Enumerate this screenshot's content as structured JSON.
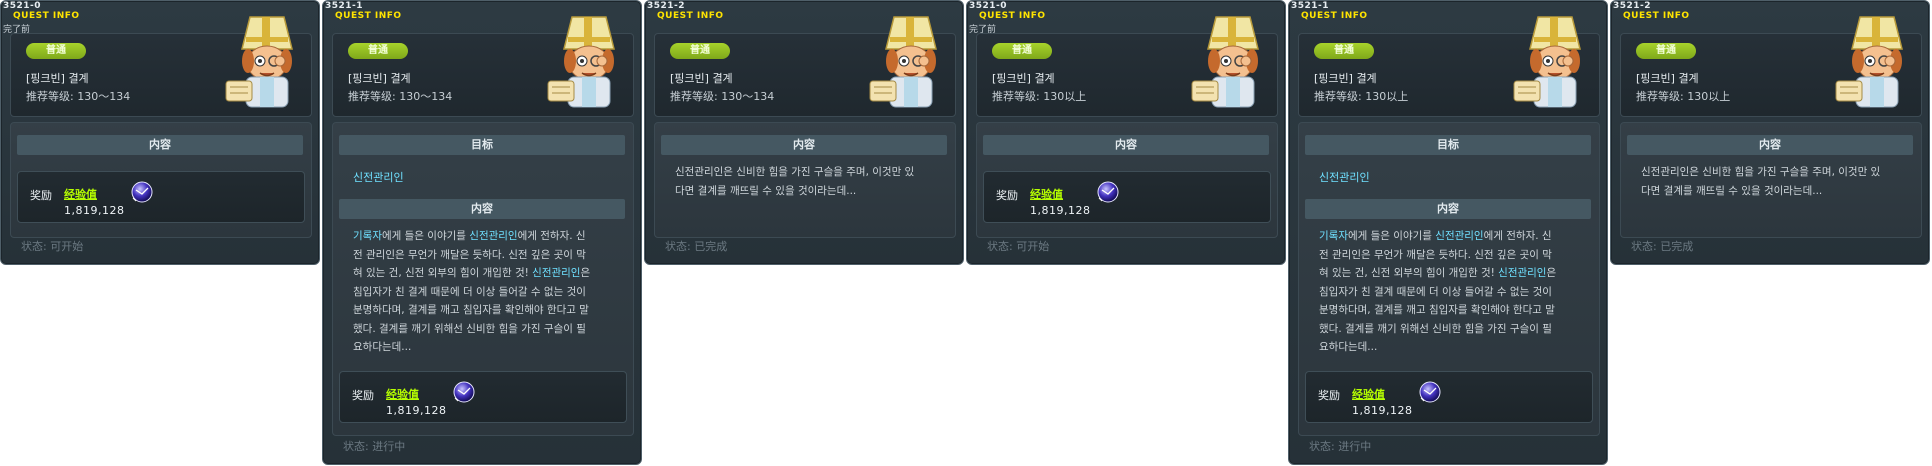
{
  "panels": [
    {
      "id": "3521-0",
      "header": "QUEST INFO",
      "state_label": "完了前",
      "badge": "普通",
      "quest_name": "[핑크빈] 결계",
      "level": "推荐等级: 130～134",
      "content_title": "内容",
      "reward": {
        "label": "奖励",
        "exp_label": "经验值",
        "exp_value": "1,819,128"
      },
      "status": "状态: 可开始"
    },
    {
      "id": "3521-1",
      "header": "QUEST INFO",
      "state_label": "",
      "badge": "普通",
      "quest_name": "[핑크빈] 결계",
      "level": "推荐等级: 130～134",
      "target_title": "目标",
      "target_name": "신전관리인",
      "content_title": "内容",
      "description": [
        [
          {
            "t": "기록자",
            "hl": true
          },
          {
            "t": "에게 들은 이야기를 "
          },
          {
            "t": "신전관리인",
            "hl": true
          },
          {
            "t": "에게 전하자. 신"
          }
        ],
        [
          {
            "t": "전 관리인은 무언가 깨달은 듯하다. 신전 깊은 곳이 막"
          }
        ],
        [
          {
            "t": "혀 있는 건, 신전 외부의 힘이 개입한 것! "
          },
          {
            "t": "신전관리인",
            "hl": true
          },
          {
            "t": "은"
          }
        ],
        [
          {
            "t": "침입자가 친 결계 때문에 더 이상 들어갈 수 없는 것이"
          }
        ],
        [
          {
            "t": "분명하다며, 결계를 깨고 침입자를 확인해야 한다고 말"
          }
        ],
        [
          {
            "t": "했다. 결계를 깨기 위해선 신비한 힘을 가진 구슬이 필"
          }
        ],
        [
          {
            "t": "요하다는데..."
          }
        ]
      ],
      "reward": {
        "label": "奖励",
        "exp_label": "经验值",
        "exp_value": "1,819,128"
      },
      "status": "状态: 进行中"
    },
    {
      "id": "3521-2",
      "header": "QUEST INFO",
      "state_label": "",
      "badge": "普通",
      "quest_name": "[핑크빈] 결계",
      "level": "推荐等级: 130～134",
      "content_title": "内容",
      "description": [
        [
          {
            "t": "신전관리인은 신비한 힘을 가진 구슬을 주며, 이것만 있"
          }
        ],
        [
          {
            "t": "다면 결계를 깨뜨릴 수 있을 것이라는데..."
          }
        ]
      ],
      "status": "状态: 已完成"
    },
    {
      "id": "3521-0",
      "header": "QUEST INFO",
      "state_label": "完了前",
      "badge": "普通",
      "quest_name": "[핑크빈] 결계",
      "level": "推荐等级: 130以上",
      "content_title": "内容",
      "reward": {
        "label": "奖励",
        "exp_label": "经验值",
        "exp_value": "1,819,128"
      },
      "status": "状态: 可开始"
    },
    {
      "id": "3521-1",
      "header": "QUEST INFO",
      "state_label": "",
      "badge": "普通",
      "quest_name": "[핑크빈] 결계",
      "level": "推荐等级: 130以上",
      "target_title": "目标",
      "target_name": "신전관리인",
      "content_title": "内容",
      "description": [
        [
          {
            "t": "기록자",
            "hl": true
          },
          {
            "t": "에게 들은 이야기를 "
          },
          {
            "t": "신전관리인",
            "hl": true
          },
          {
            "t": "에게 전하자. 신"
          }
        ],
        [
          {
            "t": "전 관리인은 무언가 깨달은 듯하다. 신전 깊은 곳이 막"
          }
        ],
        [
          {
            "t": "혀 있는 건, 신전 외부의 힘이 개입한 것! "
          },
          {
            "t": "신전관리인",
            "hl": true
          },
          {
            "t": "은"
          }
        ],
        [
          {
            "t": "침입자가 친 결계 때문에 더 이상 들어갈 수 없는 것이"
          }
        ],
        [
          {
            "t": "분명하다며, 결계를 깨고 침입자를 확인해야 한다고 말"
          }
        ],
        [
          {
            "t": "했다. 결계를 깨기 위해선 신비한 힘을 가진 구슬이 필"
          }
        ],
        [
          {
            "t": "요하다는데..."
          }
        ]
      ],
      "reward": {
        "label": "奖励",
        "exp_label": "经验值",
        "exp_value": "1,819,128"
      },
      "status": "状态: 进行中"
    },
    {
      "id": "3521-2",
      "header": "QUEST INFO",
      "state_label": "",
      "badge": "普通",
      "quest_name": "[핑크빈] 결계",
      "level": "推荐等级: 130以上",
      "content_title": "内容",
      "description": [
        [
          {
            "t": "신전관리인은 신비한 힘을 가진 구슬을 주며, 이것만 있"
          }
        ],
        [
          {
            "t": "다면 결계를 깨뜨릴 수 있을 것이라는데..."
          }
        ]
      ],
      "status": "状态: 已完成"
    }
  ],
  "colors": {
    "accent": "#ffe400",
    "highlight": "#6fe0ff",
    "badge": "#8fbe1f",
    "exp": "#b6ff00"
  },
  "icons": {
    "npc": "priest-npc-portrait",
    "orb": "exp-orb-icon"
  }
}
